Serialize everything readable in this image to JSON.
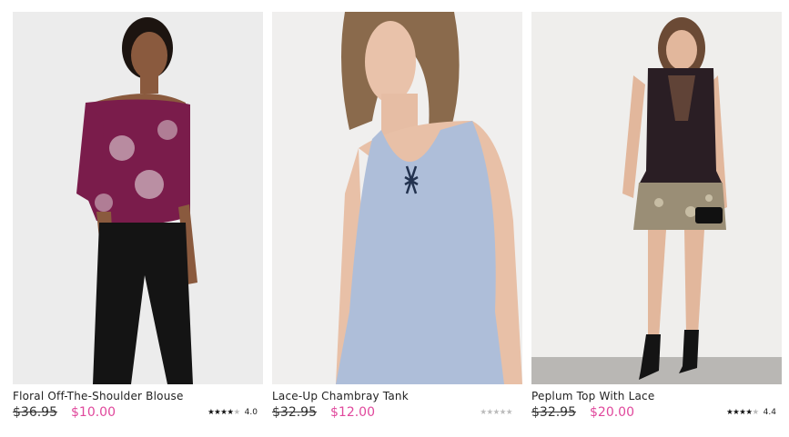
{
  "products": [
    {
      "name": "Floral Off-The-Shoulder Blouse",
      "original_price": "$36.95",
      "sale_price": "$10.00",
      "rating_value": 4.0,
      "rating_text": "4.0",
      "stars": "★★★★",
      "stars_empty": "★",
      "photo_icon": "model-floral-blouse-photo"
    },
    {
      "name": "Lace-Up Chambray Tank",
      "original_price": "$32.95",
      "sale_price": "$12.00",
      "rating_value": 0,
      "rating_text": "",
      "stars": "",
      "stars_empty": "★★★★★",
      "photo_icon": "model-chambray-tank-photo"
    },
    {
      "name": "Peplum Top With Lace",
      "original_price": "$32.95",
      "sale_price": "$20.00",
      "rating_value": 4.4,
      "rating_text": "4.4",
      "stars": "★★★★",
      "stars_empty": "★",
      "photo_icon": "model-peplum-top-photo"
    }
  ],
  "colors": {
    "sale_price": "#e0489c",
    "photo_background": "#ebebeb"
  }
}
